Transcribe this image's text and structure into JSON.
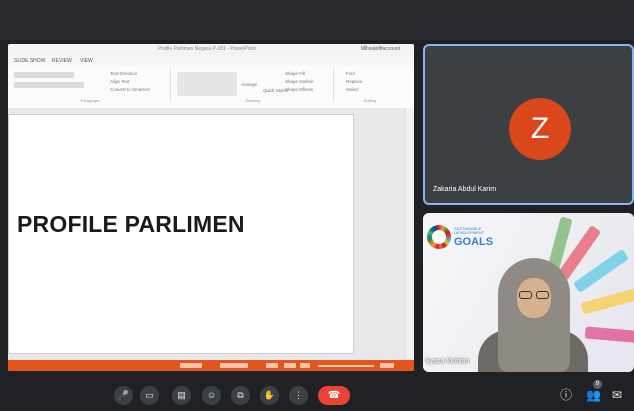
{
  "presentation": {
    "window_title": "Profile Parlimen Negara P-181 - PowerPoint",
    "account": "Microsoft account",
    "window_controls": "?  –  □  ✕",
    "tabs": [
      "SLIDE SHOW",
      "REVIEW",
      "VIEW"
    ],
    "ribbon_groups": [
      "Paragraph",
      "Drawing",
      "Editing"
    ],
    "ribbon_buttons": [
      "Text Direction",
      "Align Text",
      "Convert to SmartArt",
      "Arrange",
      "Quick Styles",
      "Shape Fill",
      "Shape Outline",
      "Shape Effects",
      "Find",
      "Replace",
      "Select"
    ],
    "slide_title": "PROFILE PARLIMEN",
    "status_color": "#e2571e"
  },
  "participants": [
    {
      "name": "Zakaria Abdul Karim",
      "initial": "Z",
      "avatar_color": "#d9471a",
      "active_speaker": true
    },
    {
      "name": "Syaza Muhlan",
      "initial": "",
      "background_logo": {
        "line1": "SUSTAINABLE DEVELOPMENT",
        "line2": "GOALS"
      }
    }
  ],
  "controls": {
    "buttons": [
      {
        "name": "microphone-button",
        "icon": "microphone-icon",
        "glyph": "🎤"
      },
      {
        "name": "camera-button",
        "icon": "camera-icon",
        "glyph": "▭"
      },
      {
        "name": "captions-button",
        "icon": "captions-icon",
        "glyph": "▤"
      },
      {
        "name": "emoji-button",
        "icon": "emoji-icon",
        "glyph": "☺"
      },
      {
        "name": "present-button",
        "icon": "present-screen-icon",
        "glyph": "⧉"
      },
      {
        "name": "raise-hand-button",
        "icon": "hand-icon",
        "glyph": "✋"
      },
      {
        "name": "more-options-button",
        "icon": "more-vert-icon",
        "glyph": "⋮"
      }
    ],
    "end_call": {
      "glyph": "☎",
      "color": "#ea4335"
    },
    "right_icons": [
      {
        "name": "info-button",
        "icon": "info-icon",
        "glyph": "ⓘ"
      },
      {
        "name": "people-button",
        "icon": "people-icon",
        "glyph": "👥"
      },
      {
        "name": "chat-button",
        "icon": "chat-icon",
        "glyph": "✉"
      }
    ],
    "participant_count": "9"
  },
  "colors": {
    "background": "#202124",
    "active_border": "#8ab4f8",
    "tile": "#3c4043"
  }
}
